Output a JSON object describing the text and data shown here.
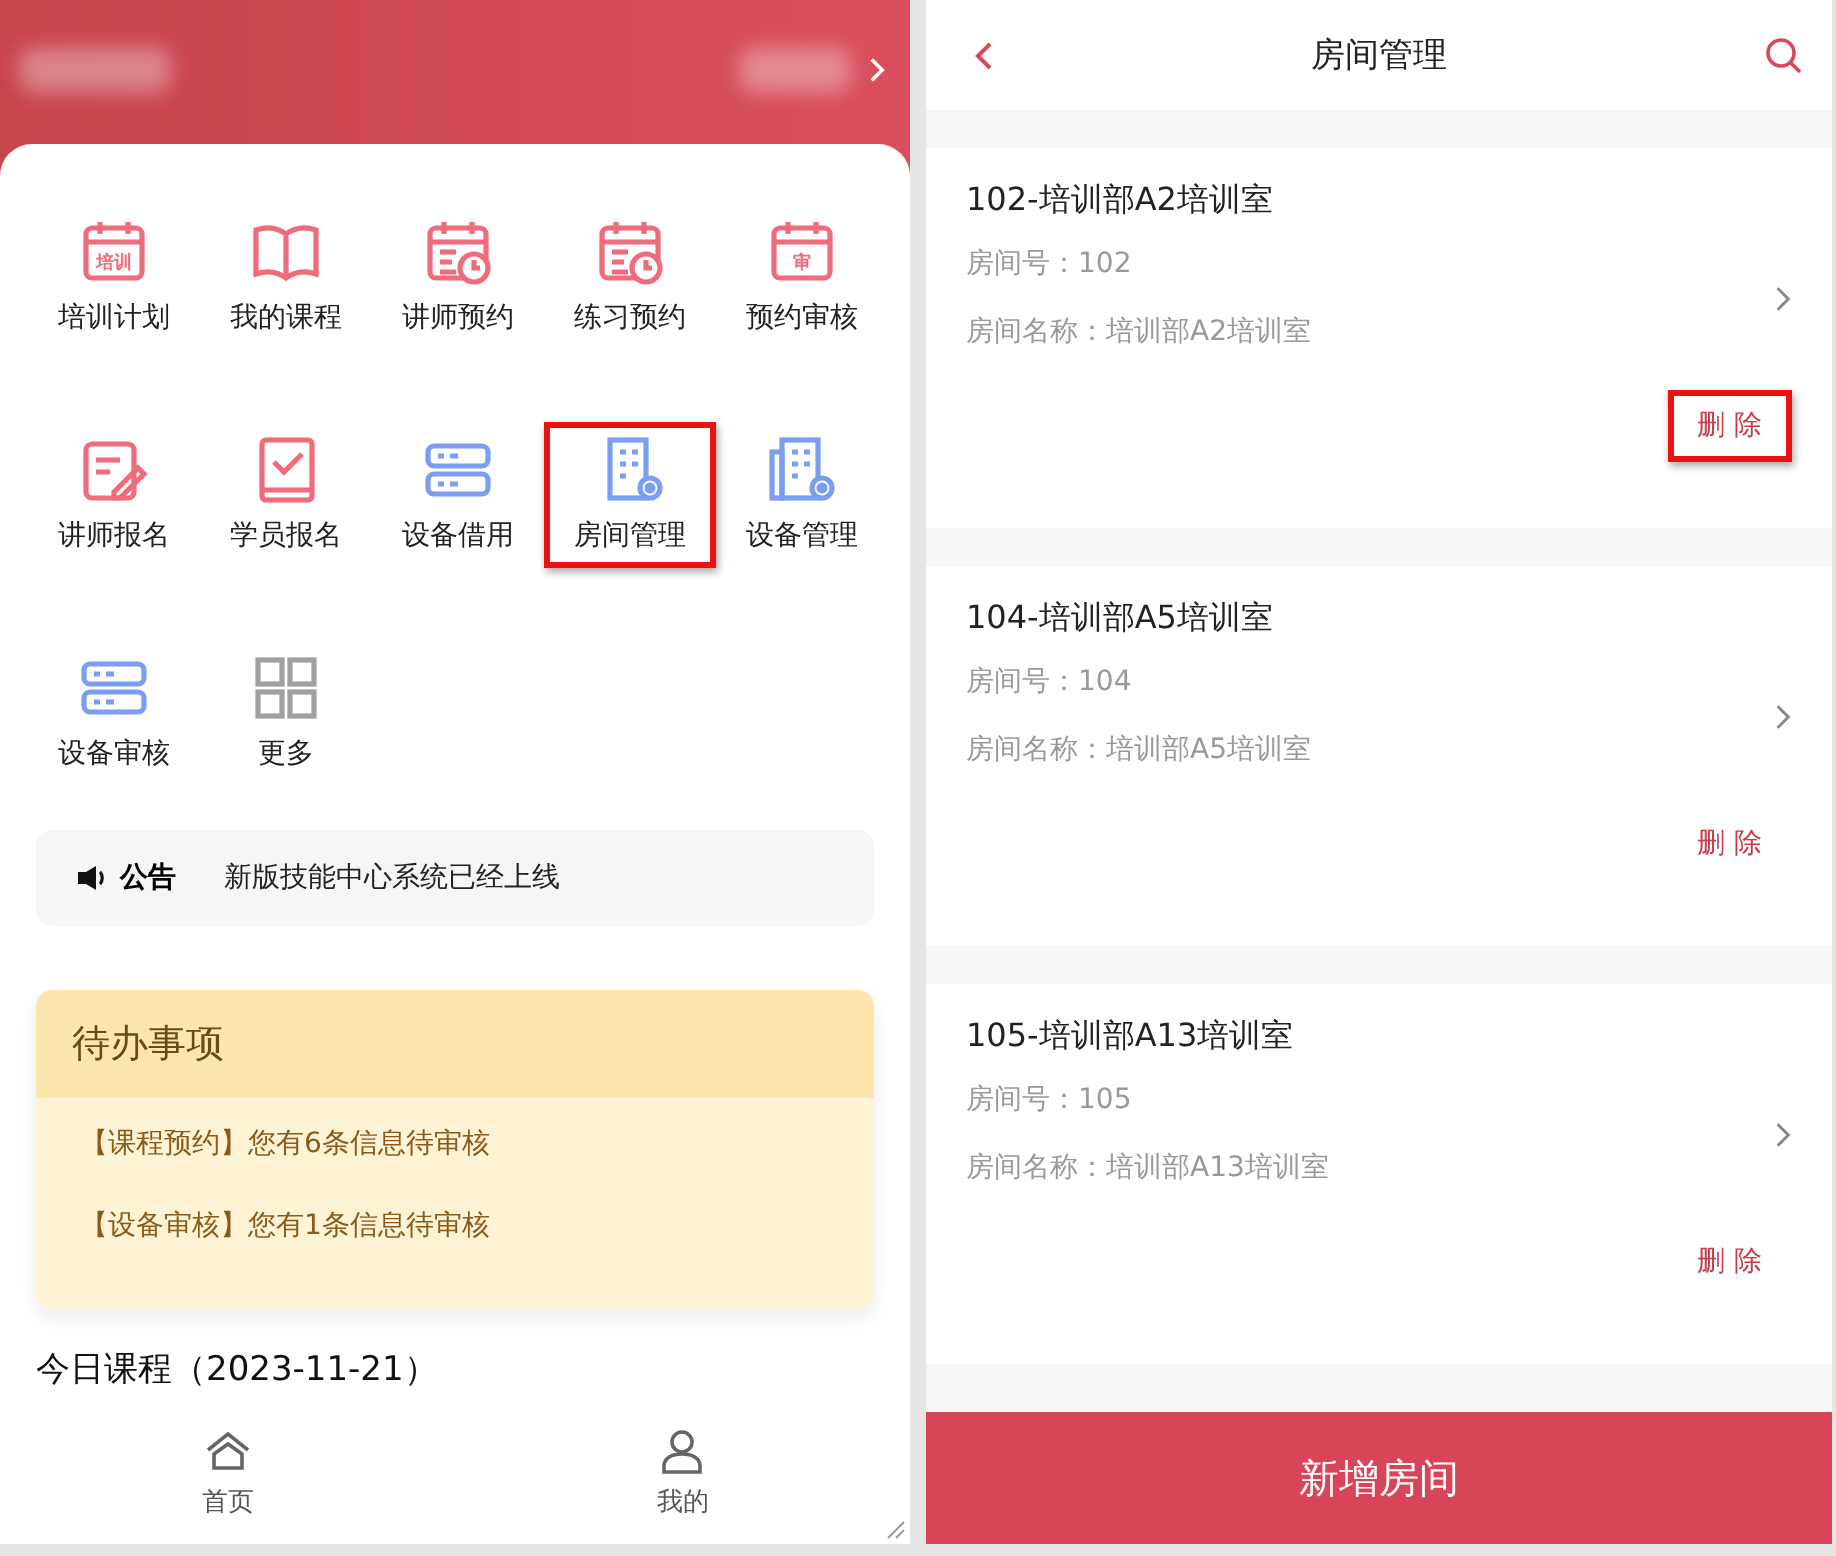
{
  "menu": [
    {
      "label": "培训计划",
      "kind": "calendar-text",
      "icon_text": "培训",
      "color": "#f06b7b",
      "highlighted": false
    },
    {
      "label": "我的课程",
      "kind": "book",
      "color": "#f06b7b",
      "highlighted": false
    },
    {
      "label": "讲师预约",
      "kind": "calendar-clock",
      "color": "#f06b7b",
      "highlighted": false
    },
    {
      "label": "练习预约",
      "kind": "calendar-clock",
      "color": "#f06b7b",
      "highlighted": false
    },
    {
      "label": "预约审核",
      "kind": "calendar-text",
      "icon_text": "审",
      "color": "#f06b7b",
      "highlighted": false
    },
    {
      "label": "讲师报名",
      "kind": "edit",
      "color": "#f06b7b",
      "highlighted": false
    },
    {
      "label": "学员报名",
      "kind": "check-book",
      "color": "#f06b7b",
      "highlighted": false
    },
    {
      "label": "设备借用",
      "kind": "server",
      "color": "#7b9ef0",
      "highlighted": false
    },
    {
      "label": "房间管理",
      "kind": "building",
      "color": "#7b9ef0",
      "highlighted": true
    },
    {
      "label": "设备管理",
      "kind": "buildings",
      "color": "#7b9ef0",
      "highlighted": false
    },
    {
      "label": "设备审核",
      "kind": "server",
      "color": "#7b9ef0",
      "highlighted": false
    },
    {
      "label": "更多",
      "kind": "grid",
      "color": "#a0a0a0",
      "highlighted": false
    }
  ],
  "notice": {
    "label": "公告",
    "text": "新版技能中心系统已经上线"
  },
  "todo": {
    "title": "待办事项",
    "items": [
      "【课程预约】您有6条信息待审核",
      "【设备审核】您有1条信息待审核"
    ]
  },
  "today_course": "今日课程（2023-11-21）",
  "tabbar": [
    {
      "label": "首页",
      "kind": "home"
    },
    {
      "label": "我的",
      "kind": "user"
    }
  ],
  "room_page": {
    "title": "房间管理",
    "rooms": [
      {
        "title": "102-培训部A2培训室",
        "number": "房间号：102",
        "name": "房间名称：培训部A2培训室",
        "delete": "删 除",
        "highlighted": true
      },
      {
        "title": "104-培训部A5培训室",
        "number": "房间号：104",
        "name": "房间名称：培训部A5培训室",
        "delete": "删 除",
        "highlighted": false
      },
      {
        "title": "105-培训部A13培训室",
        "number": "房间号：105",
        "name": "房间名称：培训部A13培训室",
        "delete": "删 除",
        "highlighted": false
      }
    ],
    "add_button": "新增房间"
  }
}
